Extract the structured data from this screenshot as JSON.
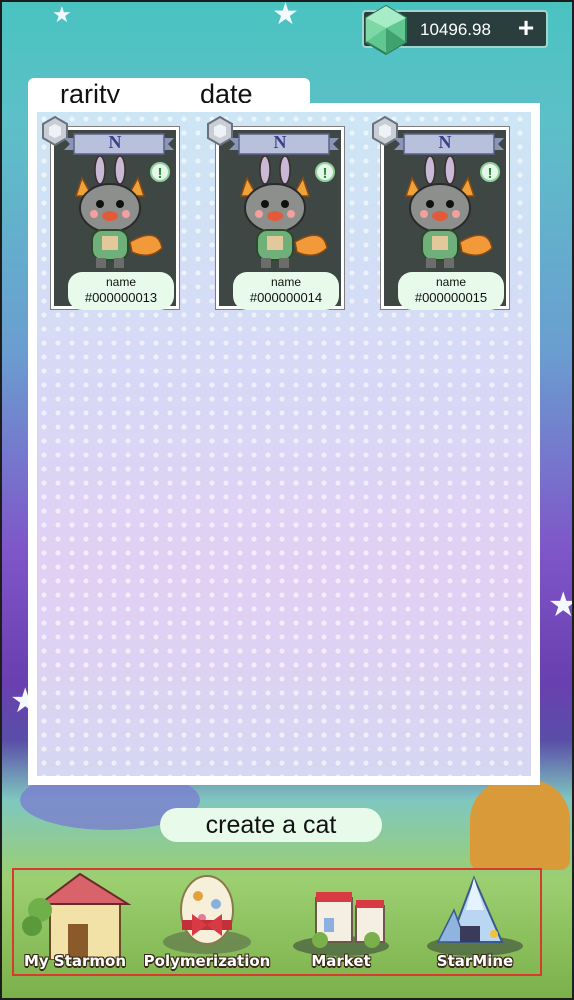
{
  "header": {
    "currency_value": "10496.98",
    "currency_icon": "green-gem-icon",
    "add_icon": "plus-icon"
  },
  "tabs": [
    {
      "label": "rarity"
    },
    {
      "label": "date"
    }
  ],
  "cards": [
    {
      "rarity": "N",
      "name": "name",
      "id": "#000000013"
    },
    {
      "rarity": "N",
      "name": "name",
      "id": "#000000014"
    },
    {
      "rarity": "N",
      "name": "name",
      "id": "#000000015"
    }
  ],
  "create_button": {
    "label": "create a cat"
  },
  "nav": {
    "items": [
      {
        "label": "My Starmon",
        "icon": "house-icon"
      },
      {
        "label": "Polymerization",
        "icon": "egg-icon"
      },
      {
        "label": "Market",
        "icon": "market-stall-icon"
      },
      {
        "label": "StarMine",
        "icon": "crystal-mine-icon"
      }
    ]
  },
  "colors": {
    "accent_green": "#8fd19a",
    "nav_frame": "#d83a2e",
    "card_dark": "#3f4745",
    "pill": "#e8fbea"
  }
}
